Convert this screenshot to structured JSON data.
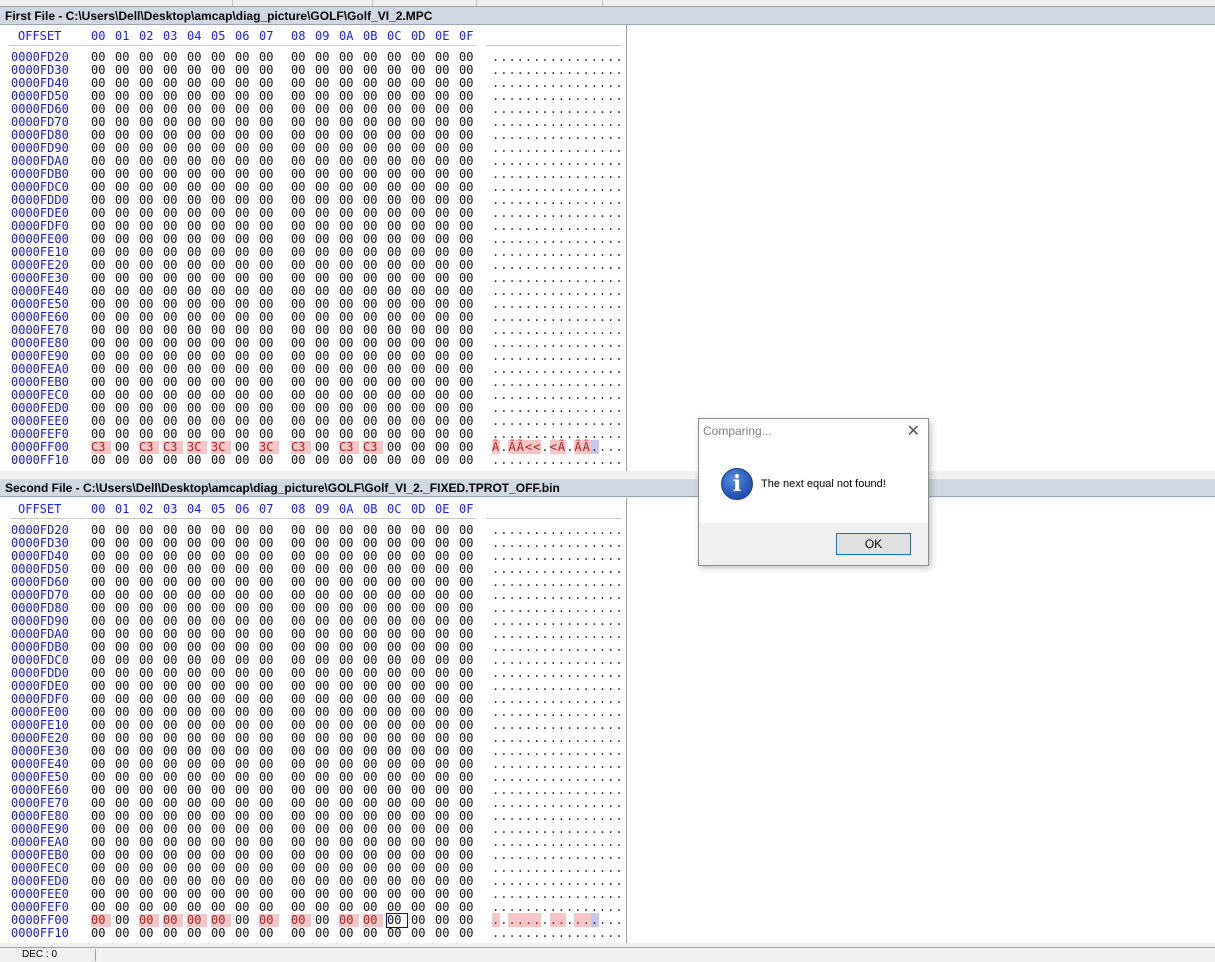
{
  "dialog": {
    "title": "Comparing...",
    "message": "The next equal not found!",
    "ok_label": "OK",
    "close_glyph": "✕",
    "icon_glyph": "i"
  },
  "status": {
    "text": "DEC : 0"
  },
  "header_columns": [
    "00",
    "01",
    "02",
    "03",
    "04",
    "05",
    "06",
    "07",
    "08",
    "09",
    "0A",
    "0B",
    "0C",
    "0D",
    "0E",
    "0F"
  ],
  "offset_header": "OFFSET",
  "pane1": {
    "title": "First File - C:\\Users\\Dell\\Desktop\\amcap\\diag_picture\\GOLF\\Golf_VI_2.MPC",
    "diff_row": {
      "offset": "0000FF00",
      "bytes": [
        "C3",
        "00",
        "C3",
        "C3",
        "3C",
        "3C",
        "00",
        "3C",
        "C3",
        "00",
        "C3",
        "C3",
        "00",
        "00",
        "00",
        "00"
      ],
      "ascii": [
        "Ã",
        ".",
        "Ã",
        "Ã",
        "<",
        "<",
        ".",
        "<",
        "Ã",
        ".",
        "Ã",
        "Ã",
        ".",
        ".",
        ".",
        "."
      ]
    },
    "last_row": {
      "offset": "0000FF10"
    }
  },
  "pane2": {
    "title": "Second File - C:\\Users\\Dell\\Desktop\\amcap\\diag_picture\\GOLF\\Golf_VI_2._FIXED.TPROT_OFF.bin",
    "diff_row": {
      "offset": "0000FF00",
      "bytes": [
        "00",
        "00",
        "00",
        "00",
        "00",
        "00",
        "00",
        "00",
        "00",
        "00",
        "00",
        "00",
        "00",
        "00",
        "00",
        "00"
      ],
      "ascii": [
        ".",
        ".",
        ".",
        ".",
        ".",
        ".",
        ".",
        ".",
        ".",
        ".",
        ".",
        ".",
        ".",
        ".",
        ".",
        "."
      ]
    },
    "last_row": {
      "offset": "0000FF10"
    }
  },
  "diff_mask": [
    true,
    false,
    true,
    true,
    true,
    true,
    false,
    true,
    true,
    false,
    true,
    true,
    false,
    false,
    false,
    false
  ],
  "selected_index": 12,
  "offsets": [
    "0000FD20",
    "0000FD30",
    "0000FD40",
    "0000FD50",
    "0000FD60",
    "0000FD70",
    "0000FD80",
    "0000FD90",
    "0000FDA0",
    "0000FDB0",
    "0000FDC0",
    "0000FDD0",
    "0000FDE0",
    "0000FDF0",
    "0000FE00",
    "0000FE10",
    "0000FE20",
    "0000FE30",
    "0000FE40",
    "0000FE50",
    "0000FE60",
    "0000FE70",
    "0000FE80",
    "0000FE90",
    "0000FEA0",
    "0000FEB0",
    "0000FEC0",
    "0000FED0",
    "0000FEE0",
    "0000FEF0"
  ],
  "zero_byte": "00",
  "zero_ascii": "................"
}
